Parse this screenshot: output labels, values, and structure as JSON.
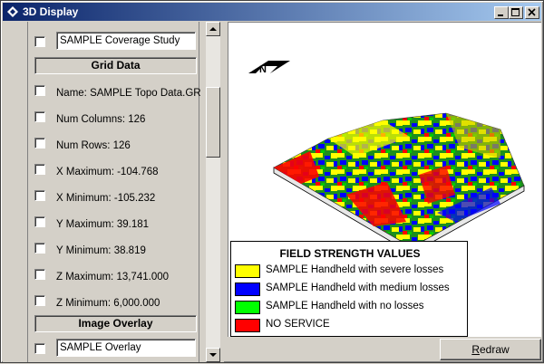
{
  "window": {
    "title": "3D Display"
  },
  "left_panel": {
    "study_name": "SAMPLE Coverage Study",
    "grid_header": "Grid Data",
    "grid_items": [
      "Name: SAMPLE Topo Data.GR",
      "Num Columns: 126",
      "Num Rows: 126",
      "X Maximum: -104.768",
      "X Minimum: -105.232",
      "Y Maximum: 39.181",
      "Y Minimum: 38.819",
      "Z Maximum: 13,741.000",
      "Z Minimum: 6,000.000"
    ],
    "overlay_header": "Image Overlay",
    "overlay_name": "SAMPLE Overlay"
  },
  "legend": {
    "title": "FIELD STRENGTH VALUES",
    "items": [
      {
        "label": "SAMPLE Handheld with severe losses",
        "color": "#ffff00"
      },
      {
        "label": "SAMPLE Handheld with medium losses",
        "color": "#0000ff"
      },
      {
        "label": "SAMPLE Handheld with no losses",
        "color": "#00ff00"
      },
      {
        "label": "NO SERVICE",
        "color": "#ff0000"
      }
    ]
  },
  "buttons": {
    "redraw_prefix": "R",
    "redraw_rest": "edraw"
  },
  "compass": {
    "letter": "N"
  }
}
